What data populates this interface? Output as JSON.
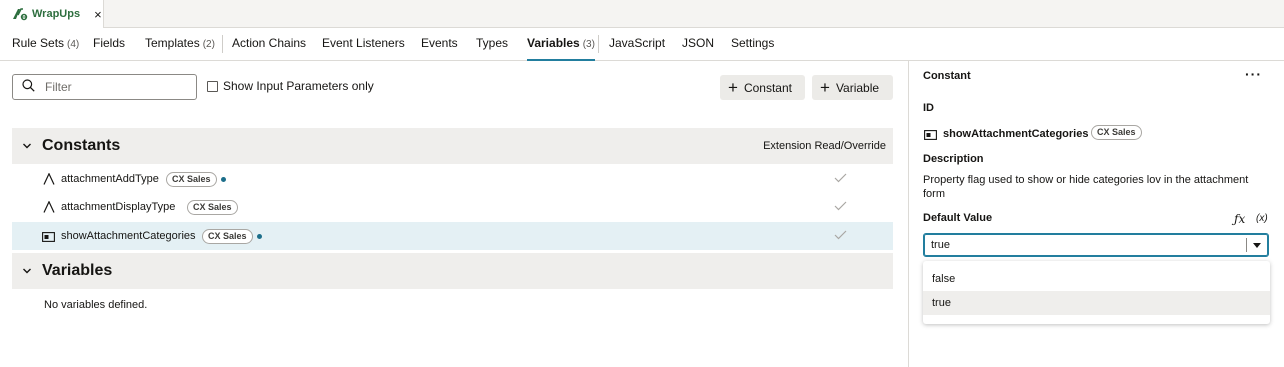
{
  "file_tab": {
    "label": "WrapUps",
    "close": "×"
  },
  "nav_tabs": [
    {
      "label": "Rule Sets",
      "count": "(4)"
    },
    {
      "label": "Fields",
      "count": ""
    },
    {
      "label": "Templates",
      "count": "(2)"
    },
    {
      "label": "Action Chains",
      "count": ""
    },
    {
      "label": "Event Listeners",
      "count": ""
    },
    {
      "label": "Events",
      "count": ""
    },
    {
      "label": "Types",
      "count": ""
    },
    {
      "label": "Variables",
      "count": "(3)"
    },
    {
      "label": "JavaScript",
      "count": ""
    },
    {
      "label": "JSON",
      "count": ""
    },
    {
      "label": "Settings",
      "count": ""
    }
  ],
  "active_tab": "Variables",
  "toolbar": {
    "filter_placeholder": "Filter",
    "show_input_params_label": "Show Input Parameters only",
    "constant_button": "Constant",
    "variable_button": "Variable"
  },
  "constants_section": {
    "title": "Constants",
    "column_header": "Extension Read/Override",
    "rows": [
      {
        "name": "attachmentAddType",
        "badge": "CX Sales",
        "type_icon": "string-type-icon",
        "modified": true,
        "extension_override": true
      },
      {
        "name": "attachmentDisplayType",
        "badge": "CX Sales",
        "type_icon": "string-type-icon",
        "modified": false,
        "extension_override": true
      },
      {
        "name": "showAttachmentCategories",
        "badge": "CX Sales",
        "type_icon": "boolean-type-icon",
        "modified": true,
        "extension_override": true,
        "selected": true
      }
    ]
  },
  "variables_section": {
    "title": "Variables",
    "empty_message": "No variables defined."
  },
  "right_panel": {
    "title": "Constant",
    "more": "···",
    "id_label": "ID",
    "id_value": "showAttachmentCategories",
    "id_badge": "CX Sales",
    "description_label": "Description",
    "description_value": "Property flag used to show or hide categories lov in the attachment form",
    "default_value_label": "Default Value",
    "fx_label": "ƒx",
    "x_label": "(x)",
    "default_value": "true",
    "options": [
      "false",
      "true"
    ],
    "highlighted_option": "true"
  },
  "colors": {
    "accent": "#227e9e",
    "modified_dot": "#1c6e8a",
    "selected_row": "#e4f0f4",
    "section_header_bg": "#efeeec",
    "file_tab_label": "#2d6e3e"
  }
}
